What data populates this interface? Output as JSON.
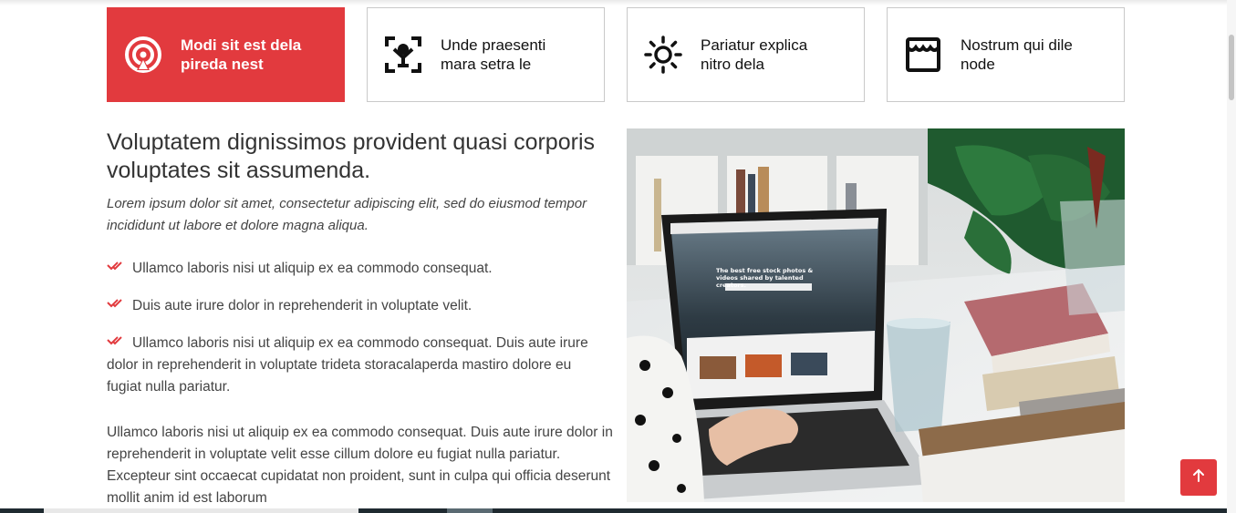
{
  "features": [
    {
      "label": "Modi sit est dela pireda nest",
      "icon": "broadcast-icon",
      "active": true
    },
    {
      "label": "Unde praesenti mara setra le",
      "icon": "face-scan-icon",
      "active": false
    },
    {
      "label": "Pariatur explica nitro dela",
      "icon": "sun-icon",
      "active": false
    },
    {
      "label": "Nostrum qui dile node",
      "icon": "store-icon",
      "active": false
    }
  ],
  "content": {
    "heading": "Voluptatem dignissimos provident quasi corporis voluptates sit assumenda.",
    "lead": "Lorem ipsum dolor sit amet, consectetur adipiscing elit, sed do eiusmod tempor incididunt ut labore et dolore magna aliqua.",
    "checklist": [
      "Ullamco laboris nisi ut aliquip ex ea commodo consequat.",
      "Duis aute irure dolor in reprehenderit in voluptate velit.",
      "Ullamco laboris nisi ut aliquip ex ea commodo consequat. Duis aute irure dolor in reprehenderit in voluptate trideta storacalaperda mastiro dolore eu fugiat nulla pariatur."
    ],
    "paragraph": "Ullamco laboris nisi ut aliquip ex ea commodo consequat. Duis aute irure dolor in reprehenderit in voluptate velit esse cillum dolore eu fugiat nulla pariatur. Excepteur sint occaecat cupidatat non proident, sunt in culpa qui officia deserunt mollit anim id est laborum"
  },
  "photo": {
    "screen_headline": "The best free stock photos & videos shared by talented creators.",
    "screen_search_placeholder": "Search for free photos and videos"
  },
  "colors": {
    "accent": "#e23a3e",
    "text": "#444444",
    "heading": "#333333"
  },
  "back_to_top_icon": "arrow-up-icon"
}
